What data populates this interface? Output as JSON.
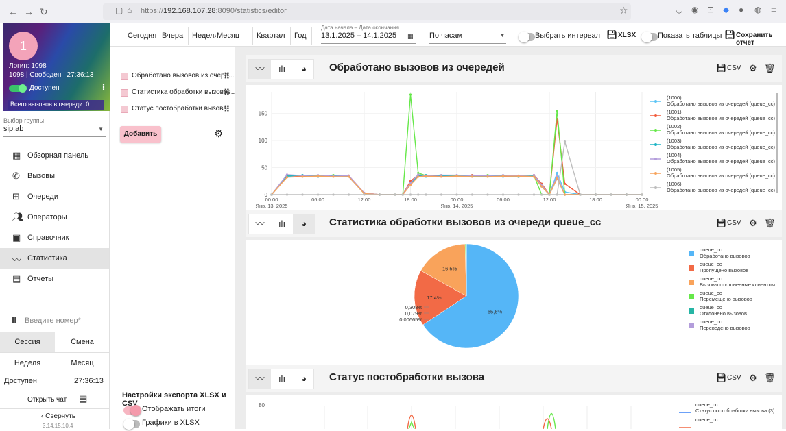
{
  "browser": {
    "url_prefix": "https://",
    "url_host": "192.168.107.28",
    "url_rest": ":8090/statistics/editor"
  },
  "sidebar": {
    "avatar_letter": "1",
    "login": "Логин: 1098",
    "status_line": "1098 | Свободен | 27:36:13",
    "availability": "Доступен",
    "queue_total": "Всего вызовов в очереди: 0",
    "group_label": "Выбор группы",
    "group_value": "sip.ab",
    "menu": [
      {
        "label": "Обзорная панель",
        "icon": "dashboard-icon"
      },
      {
        "label": "Вызовы",
        "icon": "phone-icon"
      },
      {
        "label": "Очереди",
        "icon": "queue-icon"
      },
      {
        "label": "Операторы",
        "icon": "operators-icon"
      },
      {
        "label": "Справочник",
        "icon": "contacts-icon"
      },
      {
        "label": "Статистика",
        "icon": "statistics-icon"
      },
      {
        "label": "Отчеты",
        "icon": "reports-icon"
      }
    ],
    "phone_placeholder": "Введите номер*",
    "session_tab": "Сессия",
    "shift_tab": "Смена",
    "week_label": "Неделя",
    "month_label": "Месяц",
    "status_name": "Доступен",
    "status_time": "27:36:13",
    "open_chat": "Открыть чат",
    "collapse": "Свернуть",
    "version": "3.14.15.10.4"
  },
  "toolbar": {
    "periods": [
      "Сегодня",
      "Вчера",
      "Неделя",
      "Месяц",
      "Квартал",
      "Год"
    ],
    "date_label": "Дата начала – Дата окончания",
    "date_value": "13.1.2025 – 14.1.2025",
    "granularity": "По часам",
    "select_interval": "Выбрать интервал",
    "xlsx": "XLSX",
    "show_tables": "Показать таблицы",
    "save_report": "Сохранить отчет"
  },
  "panel": {
    "widgets": [
      "Обработано вызовов из очере...",
      "Статистика обработки вызовов...",
      "Статус постобработки вызова"
    ],
    "add_button": "Добавить",
    "export_title": "Настройки экспорта XLSX и CSV",
    "show_totals": "Отображать итоги",
    "charts_in_xlsx": "Графики в XLSX"
  },
  "csv_label": "CSV",
  "colors": {
    "accent": "#f49aab",
    "series": [
      "#5bc4f5",
      "#f25c3c",
      "#66e84a",
      "#1fb5c5",
      "#b39ddb",
      "#f7a35c",
      "#bdbdbd"
    ]
  },
  "chart_data": [
    {
      "type": "line",
      "title": "Обработано вызовов из очередей",
      "x_ticks": [
        "00:00",
        "06:00",
        "12:00",
        "18:00",
        "00:00",
        "06:00",
        "12:00",
        "18:00",
        "00:00"
      ],
      "x_sub_ticks": [
        "Янв. 13, 2025",
        "Янв. 14, 2025",
        "Янв. 15, 2025"
      ],
      "y_ticks": [
        0,
        50,
        100,
        150
      ],
      "ylim": [
        0,
        190
      ],
      "x_hours": [
        0,
        2,
        4,
        6,
        8,
        10,
        12,
        14,
        16,
        17,
        18,
        19,
        20,
        22,
        24,
        26,
        28,
        30,
        32,
        34,
        35,
        36,
        37,
        38,
        40,
        42,
        44,
        46,
        48
      ],
      "series": [
        {
          "name": "(1000)",
          "desc": "Обработано вызовов из очередей (queue_cc)",
          "values": [
            0,
            33,
            36,
            34,
            35,
            33,
            2,
            0,
            0,
            0,
            20,
            35,
            33,
            34,
            35,
            34,
            35,
            33,
            34,
            35,
            20,
            0,
            40,
            5,
            0,
            0,
            0,
            0,
            0
          ]
        },
        {
          "name": "(1001)",
          "desc": "Обработано вызовов из очередей (queue_cc)",
          "values": [
            0,
            35,
            34,
            33,
            34,
            35,
            3,
            0,
            0,
            0,
            25,
            36,
            34,
            35,
            34,
            36,
            35,
            34,
            33,
            36,
            20,
            0,
            140,
            20,
            0,
            0,
            0,
            0,
            0
          ]
        },
        {
          "name": "(1002)",
          "desc": "Обработано вызовов из очередей (queue_cc)",
          "values": [
            0,
            36,
            35,
            35,
            36,
            34,
            2,
            0,
            0,
            0,
            185,
            40,
            35,
            36,
            35,
            34,
            36,
            35,
            34,
            35,
            0,
            0,
            155,
            0,
            0,
            0,
            0,
            0,
            0
          ]
        },
        {
          "name": "(1003)",
          "desc": "Обработано вызовов из очередей (queue_cc)",
          "values": [
            0,
            34,
            36,
            33,
            35,
            34,
            2,
            0,
            0,
            0,
            20,
            34,
            36,
            35,
            34,
            35,
            34,
            35,
            33,
            34,
            15,
            0,
            30,
            0,
            0,
            0,
            0,
            0,
            0
          ]
        },
        {
          "name": "(1004)",
          "desc": "Обработано вызовов из очередей (queue_cc)",
          "values": [
            0,
            37,
            35,
            36,
            34,
            35,
            3,
            0,
            0,
            0,
            22,
            37,
            35,
            36,
            36,
            35,
            35,
            36,
            35,
            36,
            18,
            0,
            35,
            0,
            0,
            0,
            0,
            0,
            0
          ]
        },
        {
          "name": "(1005)",
          "desc": "Обработано вызовов из очередей (queue_cc)",
          "values": [
            0,
            32,
            33,
            34,
            33,
            33,
            2,
            0,
            0,
            0,
            18,
            33,
            34,
            33,
            34,
            33,
            33,
            34,
            34,
            33,
            15,
            0,
            30,
            0,
            0,
            0,
            0,
            0,
            0
          ]
        },
        {
          "name": "(1006)",
          "desc": "Обработано вызовов из очередей (queue_cc)",
          "values": [
            0,
            0,
            0,
            0,
            0,
            0,
            0,
            0,
            0,
            0,
            0,
            0,
            0,
            0,
            0,
            0,
            0,
            0,
            0,
            0,
            0,
            0,
            0,
            98,
            0,
            0,
            0,
            0,
            0
          ]
        }
      ]
    },
    {
      "type": "pie",
      "title": "Статистика обработки вызовов из очереди queue_cc",
      "slices": [
        {
          "group": "queue_cc",
          "name": "Обработано вызовов",
          "value": 65.6,
          "label": "65,6%"
        },
        {
          "group": "queue_cc",
          "name": "Пропущено вызовов",
          "value": 17.4,
          "label": "17,4%"
        },
        {
          "group": "queue_cc",
          "name": "Вызовы отклоненные клиентом",
          "value": 16.5,
          "label": "16,5%"
        },
        {
          "group": "queue_cc",
          "name": "Перемещено вызовов",
          "value": 0.308,
          "label": "0,308%"
        },
        {
          "group": "queue_cc",
          "name": "Отклонено вызовов",
          "value": 0.079,
          "label": "0,079%"
        },
        {
          "group": "queue_cc",
          "name": "Переведено вызовов",
          "value": 0.00665,
          "label": "0,00665%"
        }
      ]
    },
    {
      "type": "line",
      "title": "Статус постобработки вызова",
      "y_ticks": [
        80
      ],
      "legend": [
        {
          "group": "queue_cc",
          "name": "Статус постобработки вызова (3)"
        },
        {
          "group": "queue_cc",
          "name": ""
        }
      ]
    }
  ]
}
